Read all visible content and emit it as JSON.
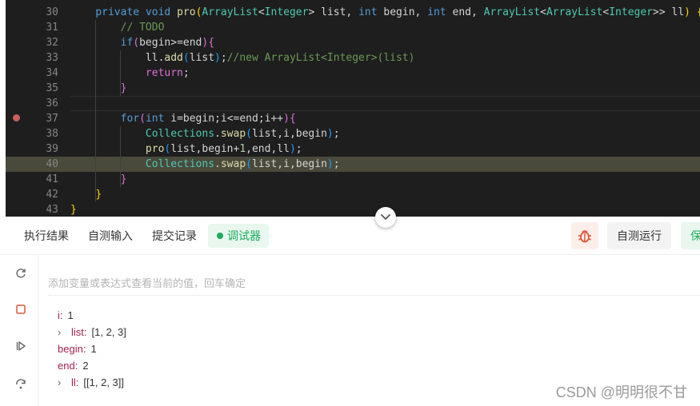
{
  "editor": {
    "lines": [
      {
        "no": "30",
        "html": "    <span class=\"kw\">private</span> <span class=\"kw\">void</span> <span class=\"fn\">pro</span><span class=\"br1\">(</span><span class=\"ty\">ArrayList</span>&lt;<span class=\"ty\">Integer</span>&gt; list, <span class=\"kw\">int</span> begin, <span class=\"kw\">int</span> end, <span class=\"ty\">ArrayList</span>&lt;<span class=\"ty\">ArrayList</span>&lt;<span class=\"ty\">Integer</span>&gt;&gt; ll<span class=\"br1\">)</span> <span class=\"br1\">{</span>"
      },
      {
        "no": "31",
        "html": "        <span class=\"cm\">// TODO</span>"
      },
      {
        "no": "32",
        "html": "        <span class=\"kw\">if</span><span class=\"br2\">(</span>begin&gt;=end<span class=\"br2\">)</span><span class=\"br2\">{</span>"
      },
      {
        "no": "33",
        "html": "            ll.<span class=\"fn\">add</span><span class=\"br3\">(</span>list<span class=\"br3\">)</span>;<span class=\"cm\">//new ArrayList&lt;Integer&gt;(list)</span>"
      },
      {
        "no": "34",
        "html": "            <span class=\"br2\">return</span>;"
      },
      {
        "no": "35",
        "html": "        <span class=\"br2\">}</span>"
      },
      {
        "no": "36",
        "html": ""
      },
      {
        "no": "37",
        "html": "        <span class=\"kw\">for</span><span class=\"br2\">(</span><span class=\"kw\">int</span> i=begin;i&lt;=end;i++<span class=\"br2\">)</span><span class=\"br2\">{</span>"
      },
      {
        "no": "38",
        "html": "            <span class=\"ty\">Collections</span>.<span class=\"fn\">swap</span><span class=\"br3\">(</span>list,i,begin<span class=\"br3\">)</span>;"
      },
      {
        "no": "39",
        "html": "            <span class=\"fn\">pro</span><span class=\"br3\">(</span>list,begin+<span class=\"num\">1</span>,end,ll<span class=\"br3\">)</span>;"
      },
      {
        "no": "40",
        "html": "            <span class=\"ty\">Collections</span>.<span class=\"fn\">swap</span><span class=\"br3\">(</span>list,i,begin<span class=\"br3\">)</span>;"
      },
      {
        "no": "41",
        "html": "        <span class=\"br2\">}</span>"
      },
      {
        "no": "42",
        "html": "    <span class=\"br1\">}</span>"
      },
      {
        "no": "43",
        "html": "<span class=\"br1\">}</span>"
      }
    ],
    "breakpoint_line": "37",
    "highlighted_line": "40",
    "cursor_line": "36"
  },
  "tabs": {
    "run_result": "执行结果",
    "custom_input": "自测输入",
    "submissions": "提交记录",
    "debugger": "调试器"
  },
  "actions": {
    "debug_icon": "bug-icon",
    "run_label": "自测运行",
    "save_label": "保"
  },
  "debugger": {
    "watch_placeholder": "添加变量或表达式查看当前的值，回车确定",
    "sidebar_icons": [
      "restart-icon",
      "stop-icon",
      "continue-icon",
      "step-over-icon"
    ],
    "variables": [
      {
        "name": "i",
        "value": "1",
        "expandable": false
      },
      {
        "name": "list",
        "value": "[1, 2, 3]",
        "expandable": true
      },
      {
        "name": "begin",
        "value": "1",
        "expandable": false
      },
      {
        "name": "end",
        "value": "2",
        "expandable": false
      },
      {
        "name": "ll",
        "value": "[[1, 2, 3]]",
        "expandable": true
      }
    ]
  },
  "watermark": "CSDN @明明很不甘",
  "colors": {
    "accent_green": "#1aad5c",
    "debug_red": "#e1573b",
    "breakpoint": "#c95f5f"
  }
}
